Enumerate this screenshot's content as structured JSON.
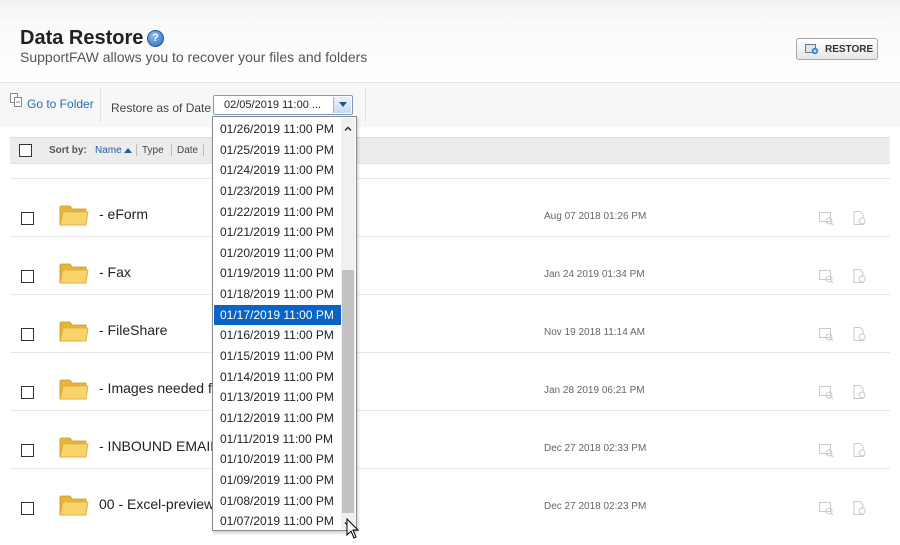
{
  "header": {
    "title": "Data Restore",
    "help_glyph": "?",
    "subtitle": "SupportFAW allows you to recover your files and folders",
    "restore_button": "RESTORE"
  },
  "toolbar": {
    "goto_folder": "Go to Folder",
    "restore_as_of_label": "Restore as of Date",
    "selected_date": "02/05/2019 11:00 ..."
  },
  "sortbar": {
    "sort_by": "Sort by:",
    "name": "Name",
    "type": "Type",
    "date": "Date"
  },
  "rows": [
    {
      "name": "- eForm",
      "date": "Aug 07 2018 01:26 PM"
    },
    {
      "name": "- Fax",
      "date": "Jan 24 2019 01:34 PM"
    },
    {
      "name": "- FileShare",
      "date": "Nov 19 2018 11:14 AM"
    },
    {
      "name": "- Images needed fr",
      "date": "Jan 28 2019 06:21 PM"
    },
    {
      "name": "- INBOUND EMAIL",
      "date": "Dec 27 2018 02:33 PM"
    },
    {
      "name": "00 - Excel-preview",
      "date": "Dec 27 2018 02:23 PM"
    }
  ],
  "dropdown": {
    "options": [
      "01/26/2019 11:00 PM",
      "01/25/2019 11:00 PM",
      "01/24/2019 11:00 PM",
      "01/23/2019 11:00 PM",
      "01/22/2019 11:00 PM",
      "01/21/2019 11:00 PM",
      "01/20/2019 11:00 PM",
      "01/19/2019 11:00 PM",
      "01/18/2019 11:00 PM",
      "01/17/2019 11:00 PM",
      "01/16/2019 11:00 PM",
      "01/15/2019 11:00 PM",
      "01/14/2019 11:00 PM",
      "01/13/2019 11:00 PM",
      "01/12/2019 11:00 PM",
      "01/11/2019 11:00 PM",
      "01/10/2019 11:00 PM",
      "01/09/2019 11:00 PM",
      "01/08/2019 11:00 PM",
      "01/07/2019 11:00 PM"
    ],
    "selected": "01/17/2019 11:00 PM"
  },
  "colors": {
    "accent": "#0a64c8",
    "link": "#2a6db5",
    "folder": "#f5c84c"
  },
  "icons": {
    "help": "help-icon",
    "restore": "restore-icon",
    "goto": "goto-folder-icon",
    "folder": "folder-icon",
    "preview": "preview-icon",
    "restore_file": "restore-file-icon",
    "sort": "sort-ascending-icon",
    "cursor": "mouse-cursor-icon"
  }
}
